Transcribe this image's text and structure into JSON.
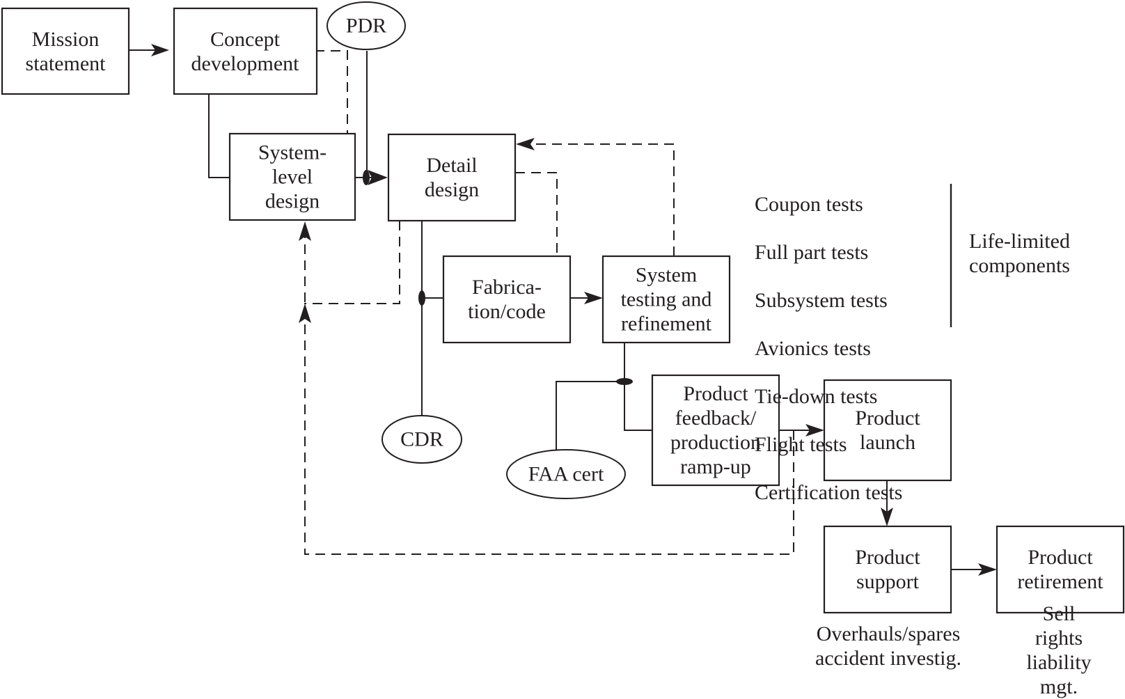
{
  "nodes": {
    "mission_statement": "Mission\nstatement",
    "concept_development": "Concept\ndevelopment",
    "pdr": "PDR",
    "system_level_design": "System-\nlevel\ndesign",
    "detail_design": "Detail\ndesign",
    "fabrication_code": "Fabrica-\ntion/code",
    "system_testing": "System\ntesting and\nrefinement",
    "cdr": "CDR",
    "faa_cert": "FAA cert",
    "product_feedback": "Product\nfeedback/\nproduction\nramp-up",
    "product_launch": "Product\nlaunch",
    "product_support": "Product\nsupport",
    "product_retirement": "Product\nretirement"
  },
  "tests_list": [
    "Coupon tests",
    "Full part tests",
    "Subsystem tests",
    "Avionics tests",
    "Tie-down tests",
    "Flight tests",
    "Certification tests"
  ],
  "side_note": "Life-limited\ncomponents",
  "captions": {
    "support": "Overhauls/spares\naccident investig.",
    "retirement": "Sell rights\nliability mgt."
  },
  "edges": [
    {
      "from": "mission_statement",
      "to": "concept_development",
      "style": "solid"
    },
    {
      "from": "concept_development",
      "to": "system_level_design",
      "style": "solid"
    },
    {
      "from": "system_level_design",
      "to": "detail_design",
      "style": "solid"
    },
    {
      "from": "pdr",
      "to": "detail_design",
      "style": "solid"
    },
    {
      "from": "detail_design",
      "to": "fabrication_code",
      "style": "solid"
    },
    {
      "from": "cdr",
      "to": "fabrication_code",
      "style": "solid"
    },
    {
      "from": "fabrication_code",
      "to": "system_testing",
      "style": "solid"
    },
    {
      "from": "system_testing",
      "to": "product_feedback",
      "style": "solid"
    },
    {
      "from": "faa_cert",
      "to": "product_feedback",
      "style": "solid"
    },
    {
      "from": "product_feedback",
      "to": "product_launch",
      "style": "solid"
    },
    {
      "from": "product_launch",
      "to": "product_support",
      "style": "solid"
    },
    {
      "from": "product_support",
      "to": "product_retirement",
      "style": "solid"
    },
    {
      "from": "concept_development",
      "to": "system_level_design",
      "style": "dashed"
    },
    {
      "from": "detail_design",
      "to": "system_level_design",
      "style": "dashed"
    },
    {
      "from": "fabrication_code",
      "to": "detail_design",
      "style": "dashed"
    },
    {
      "from": "system_testing",
      "to": "detail_design",
      "style": "dashed"
    },
    {
      "from": "product_feedback",
      "to": "system_level_design",
      "style": "dashed"
    }
  ]
}
